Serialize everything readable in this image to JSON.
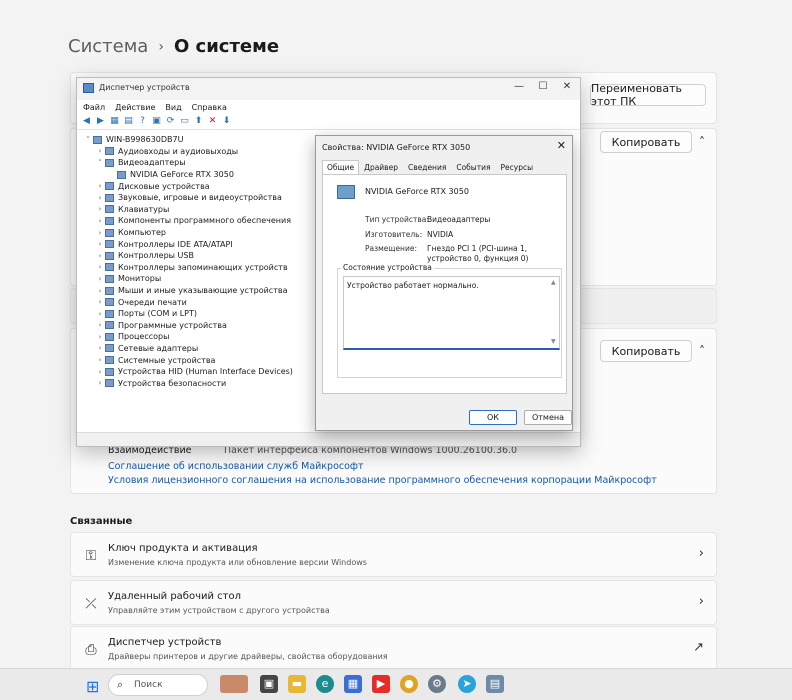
{
  "breadcrumb": {
    "parent": "Система",
    "separator": "›",
    "current": "О системе"
  },
  "settings": {
    "rename_button": "Переименовать этот ПК",
    "copy_button_1": "Копировать",
    "copy_button_2": "Копировать",
    "interaction_label": "Взаимодействие",
    "interaction_value": "Пакет интерфейса компонентов Windows 1000.26100.36.0",
    "link_services": "Соглашение об использовании служб Майкрософт",
    "link_license": "Условия лицензионного соглашения на использование программного обеспечения корпорации Майкрософт",
    "related_title": "Связанные",
    "related": [
      {
        "title": "Ключ продукта и активация",
        "subtitle": "Изменение ключа продукта или обновление версии Windows"
      },
      {
        "title": "Удаленный рабочий стол",
        "subtitle": "Управляйте этим устройством с другого устройства"
      },
      {
        "title": "Диспетчер устройств",
        "subtitle": "Драйверы принтеров и другие драйверы, свойства оборудования"
      }
    ]
  },
  "device_manager": {
    "title": "Диспетчер устройств",
    "menu": [
      "Файл",
      "Действие",
      "Вид",
      "Справка"
    ],
    "tree": [
      {
        "label": "WIN-B998630DB7U",
        "level": 0,
        "expander": "˅"
      },
      {
        "label": "Аудиовходы и аудиовыходы",
        "level": 1,
        "expander": "›"
      },
      {
        "label": "Видеоадаптеры",
        "level": 1,
        "expander": "˅"
      },
      {
        "label": "NVIDIA GeForce RTX 3050",
        "level": 2,
        "expander": ""
      },
      {
        "label": "Дисковые устройства",
        "level": 1,
        "expander": "›"
      },
      {
        "label": "Звуковые, игровые и видеоустройства",
        "level": 1,
        "expander": "›"
      },
      {
        "label": "Клавиатуры",
        "level": 1,
        "expander": "›"
      },
      {
        "label": "Компоненты программного обеспечения",
        "level": 1,
        "expander": "›"
      },
      {
        "label": "Компьютер",
        "level": 1,
        "expander": "›"
      },
      {
        "label": "Контроллеры IDE ATA/ATAPI",
        "level": 1,
        "expander": "›"
      },
      {
        "label": "Контроллеры USB",
        "level": 1,
        "expander": "›"
      },
      {
        "label": "Контроллеры запоминающих устройств",
        "level": 1,
        "expander": "›"
      },
      {
        "label": "Мониторы",
        "level": 1,
        "expander": "›"
      },
      {
        "label": "Мыши и иные указывающие устройства",
        "level": 1,
        "expander": "›"
      },
      {
        "label": "Очереди печати",
        "level": 1,
        "expander": "›"
      },
      {
        "label": "Порты (COM и LPT)",
        "level": 1,
        "expander": "›"
      },
      {
        "label": "Программные устройства",
        "level": 1,
        "expander": "›"
      },
      {
        "label": "Процессоры",
        "level": 1,
        "expander": "›"
      },
      {
        "label": "Сетевые адаптеры",
        "level": 1,
        "expander": "›"
      },
      {
        "label": "Системные устройства",
        "level": 1,
        "expander": "›"
      },
      {
        "label": "Устройства HID (Human Interface Devices)",
        "level": 1,
        "expander": "›"
      },
      {
        "label": "Устройства безопасности",
        "level": 1,
        "expander": "›"
      }
    ]
  },
  "properties_dialog": {
    "title": "Свойства: NVIDIA GeForce RTX 3050",
    "tabs": [
      "Общие",
      "Драйвер",
      "Сведения",
      "События",
      "Ресурсы"
    ],
    "device_name": "NVIDIA GeForce RTX 3050",
    "type_label": "Тип устройства:",
    "type_value": "Видеоадаптеры",
    "maker_label": "Изготовитель:",
    "maker_value": "NVIDIA",
    "location_label": "Размещение:",
    "location_value": "Гнездо PCI 1 (PCI-шина 1, устройство 0, функция 0)",
    "status_legend": "Состояние устройства",
    "status_text": "Устройство работает нормально.",
    "ok": "ОК",
    "cancel": "Отмена"
  },
  "taskbar": {
    "search_placeholder": "Поиск"
  }
}
